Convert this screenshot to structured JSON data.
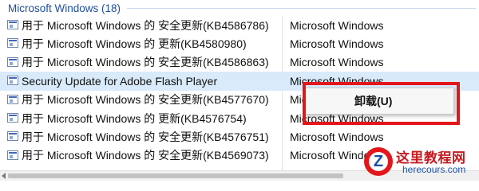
{
  "group": {
    "title": "Microsoft Windows (18)"
  },
  "updates": [
    {
      "name": "用于 Microsoft Windows 的 安全更新(KB4586786)",
      "publisher": "Microsoft Windows"
    },
    {
      "name": "用于 Microsoft Windows 的 更新(KB4580980)",
      "publisher": "Microsoft Windows"
    },
    {
      "name": "用于 Microsoft Windows 的 安全更新(KB4586863)",
      "publisher": "Microsoft Windows"
    },
    {
      "name": "Security Update for Adobe Flash Player",
      "publisher": "Microsoft Windows",
      "selected": true
    },
    {
      "name": "用于 Microsoft Windows 的 安全更新(KB4577670)",
      "publisher": "Microsoft Windows"
    },
    {
      "name": "用于 Microsoft Windows 的 更新(KB4576754)",
      "publisher": "Microsoft Windows"
    },
    {
      "name": "用于 Microsoft Windows 的 安全更新(KB4576751)",
      "publisher": "Microsoft Windows"
    },
    {
      "name": "用于 Microsoft Windows 的 安全更新(KB4569073)",
      "publisher": "Microsoft Windows"
    }
  ],
  "context_menu": {
    "uninstall_label": "卸载(U)"
  },
  "watermark": {
    "title": "这里教程网",
    "url": "herecours.com",
    "logo_letter": "Z"
  },
  "colors": {
    "group_header": "#1f4e9c",
    "selection": "#d9ebfb",
    "highlight_box": "#e3161b"
  }
}
